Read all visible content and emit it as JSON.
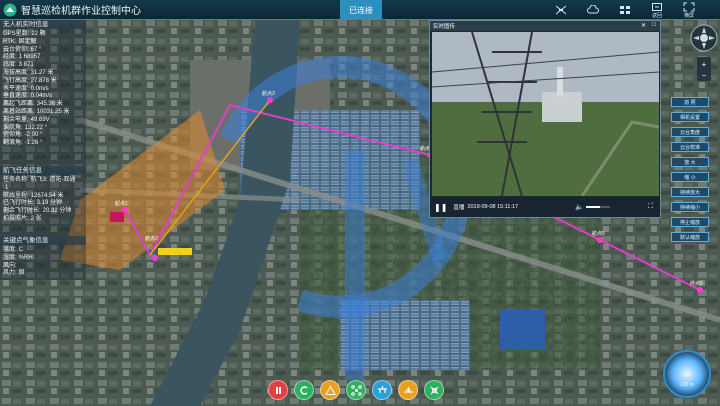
{
  "header": {
    "title": "智慧巡检机群作业控制中心",
    "status": "已连接",
    "buttons": [
      {
        "label": "",
        "icon": "drone-icon"
      },
      {
        "label": "",
        "icon": "cloud-icon"
      },
      {
        "label": "",
        "icon": "grid-icon"
      },
      {
        "label": "返回",
        "icon": "back-icon"
      },
      {
        "label": "横屏",
        "icon": "expand-icon"
      }
    ]
  },
  "uav_info": {
    "title": "无人机实时信息",
    "rows": [
      {
        "k": "GPS星数:",
        "v": "22 颗"
      },
      {
        "k": "RTK:",
        "v": "固定解"
      },
      {
        "k": "云台俯仰:",
        "v": "67 °"
      },
      {
        "k": "经度:",
        "v": "1     68957"
      },
      {
        "k": "纬度:",
        "v": "3      871"
      },
      {
        "k": "海拔高度:",
        "v": "31.27 米"
      },
      {
        "k": "飞行高度:",
        "v": "27.878 米"
      },
      {
        "k": "水平速度:",
        "v": "0.0m/s"
      },
      {
        "k": "垂直速度:",
        "v": "0.04m/s"
      },
      {
        "k": "离起飞距离:",
        "v": "345.36 米"
      },
      {
        "k": "离基站距离:",
        "v": "10031.25 米"
      },
      {
        "k": "剩余电量:",
        "v": "49.69V"
      },
      {
        "k": "偏航角:",
        "v": "132.22 °"
      },
      {
        "k": "俯仰角:",
        "v": "-2.00 °"
      },
      {
        "k": "翻滚角:",
        "v": "-1.26 °"
      }
    ]
  },
  "mission_info": {
    "title": "航飞任务信息",
    "rows": [
      {
        "k": "任务名称:",
        "v": "航飞3: 道花-双通"
      },
      {
        "k": "",
        "v": "1"
      },
      {
        "k": "航线里程:",
        "v": "12674.54 米"
      },
      {
        "k": "已飞行时长:",
        "v": "3.19 分钟"
      },
      {
        "k": "剩余飞行时长:",
        "v": "20.32 分钟"
      },
      {
        "k": "拍摄照片:",
        "v": "2 张"
      }
    ]
  },
  "weather_info": {
    "title": "关键点气象信息",
    "rows": [
      {
        "k": "温度:",
        "v": "C"
      },
      {
        "k": "湿度:",
        "v": "%RH"
      },
      {
        "k": "风向:",
        "v": ""
      },
      {
        "k": "风力:",
        "v": "级"
      }
    ]
  },
  "video": {
    "title": "实时图传",
    "live_label": "直播",
    "timestamp": "2019-09-08 15:11:17",
    "volume": 0.6
  },
  "controls": [
    "前 照",
    "相机设置",
    "云台角度",
    "云台校准",
    "放 大",
    "缩 小",
    "持续放大",
    "持续缩小",
    "停止缩放",
    "默认缩放"
  ],
  "bottom_actions": [
    {
      "icon": "pause-icon",
      "color": "#e04040"
    },
    {
      "icon": "return-icon",
      "color": "#2fb060"
    },
    {
      "icon": "warning-icon",
      "color": "#e8a020"
    },
    {
      "icon": "drone-icon",
      "color": "#2fb060"
    },
    {
      "icon": "takeoff-icon",
      "color": "#2a9fd8"
    },
    {
      "icon": "land-icon",
      "color": "#e8a020"
    },
    {
      "icon": "rotor-icon",
      "color": "#2fb060"
    }
  ],
  "map": {
    "scale_label": "100 m",
    "waypoints": [
      "起点1",
      "航点2",
      "航点3",
      "航点4",
      "航点5",
      "终点6"
    ]
  }
}
